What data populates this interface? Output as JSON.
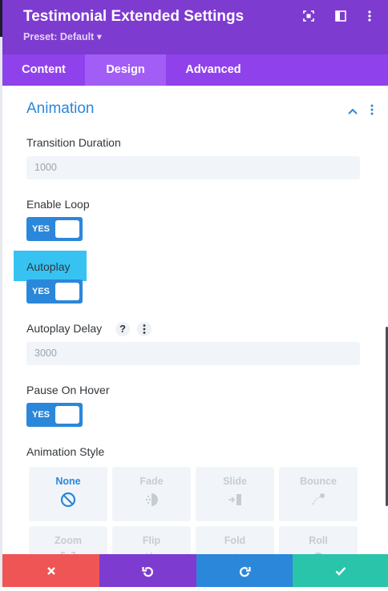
{
  "header": {
    "title": "Testimonial Extended Settings",
    "preset": "Preset: Default ▾",
    "icons": [
      "focus-icon",
      "split-view-icon",
      "more-vertical-icon"
    ]
  },
  "tabs": [
    {
      "label": "Content",
      "active": false
    },
    {
      "label": "Design",
      "active": true
    },
    {
      "label": "Advanced",
      "active": false
    }
  ],
  "section": {
    "title": "Animation"
  },
  "fields": {
    "transition_duration": {
      "label": "Transition Duration",
      "value": "1000"
    },
    "enable_loop": {
      "label": "Enable Loop",
      "toggle": "YES"
    },
    "autoplay": {
      "label": "Autoplay",
      "toggle": "YES"
    },
    "autoplay_delay": {
      "label": "Autoplay Delay",
      "help": "?",
      "value": "3000"
    },
    "pause_on_hover": {
      "label": "Pause On Hover",
      "toggle": "YES"
    },
    "animation_style": {
      "label": "Animation Style",
      "options": [
        "None",
        "Fade",
        "Slide",
        "Bounce",
        "Zoom",
        "Flip",
        "Fold",
        "Roll"
      ],
      "selected": "None"
    }
  },
  "colors": {
    "header_bg": "#7e3bd0",
    "tabs_bg": "#8f42ec",
    "tab_active_bg": "#a25df6",
    "accent_blue": "#2b87da",
    "highlight": "#36c3f2",
    "cancel": "#ef5555",
    "undo": "#7e3bd0",
    "redo": "#2b87da",
    "save": "#29c4a9"
  },
  "footer": {
    "buttons": [
      "close-icon",
      "undo-icon",
      "redo-icon",
      "check-icon"
    ]
  }
}
